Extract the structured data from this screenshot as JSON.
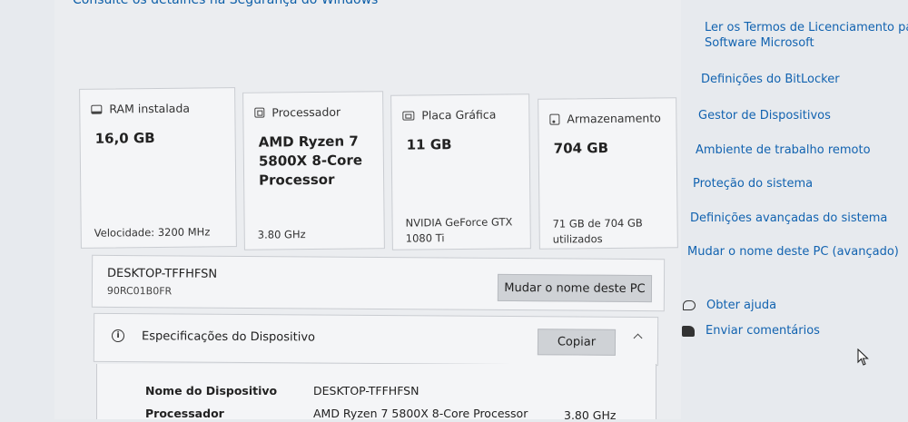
{
  "top_link": "Consulte os detalhes na Segurança do Windows",
  "cards": [
    {
      "icon": "ram-icon",
      "title": "RAM instalada",
      "value": "16,0 GB",
      "sub": [
        "Velocidade: 3200 MHz"
      ]
    },
    {
      "icon": "processor-icon",
      "title": "Processador",
      "value": "AMD Ryzen 7 5800X 8-Core Processor",
      "sub": [
        "3.80 GHz"
      ]
    },
    {
      "icon": "gpu-icon",
      "title": "Placa Gráfica",
      "value": "11 GB",
      "sub": [
        "NVIDIA GeForce GTX",
        "1080 Ti"
      ]
    },
    {
      "icon": "storage-icon",
      "title": "Armazenamento",
      "value": "704 GB",
      "sub": [
        "71 GB de 704 GB",
        "utilizados"
      ]
    }
  ],
  "pc": {
    "name": "DESKTOP-TFFHFSN",
    "id": "90RC01B0FR",
    "rename_button": "Mudar o nome deste PC"
  },
  "specs": {
    "title": "Especificações do Dispositivo",
    "copy_button": "Copiar",
    "rows": [
      {
        "label": "Nome do Dispositivo",
        "value": "DESKTOP-TFFHFSN",
        "extra": ""
      },
      {
        "label": "Processador",
        "value": "AMD Ryzen 7 5800X 8-Core Processor",
        "extra": "3.80 GHz"
      }
    ]
  },
  "related_links": [
    "Ler os Termos de Licenciamento para",
    "Software Microsoft",
    "Definições do BitLocker",
    "Gestor de Dispositivos",
    "Ambiente de trabalho remoto",
    "Proteção do sistema",
    "Definições avançadas do sistema",
    "Mudar o nome deste PC (avançado)"
  ],
  "help": {
    "get_help": "Obter ajuda",
    "feedback": "Enviar comentários"
  }
}
